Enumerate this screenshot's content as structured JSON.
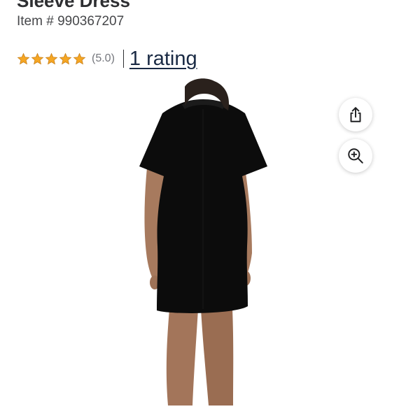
{
  "product": {
    "title": "Sleeve Dress",
    "item_number": "Item # 990367207"
  },
  "rating": {
    "stars": 5,
    "max_stars": 5,
    "score_text": "(5.0)",
    "count_link": "1 rating",
    "star_color": "#f5a623"
  },
  "actions": {
    "share_icon": "share-icon",
    "zoom_icon": "zoom-in-icon"
  },
  "image": {
    "subject": "woman wearing black short sleeve dress, back view"
  }
}
